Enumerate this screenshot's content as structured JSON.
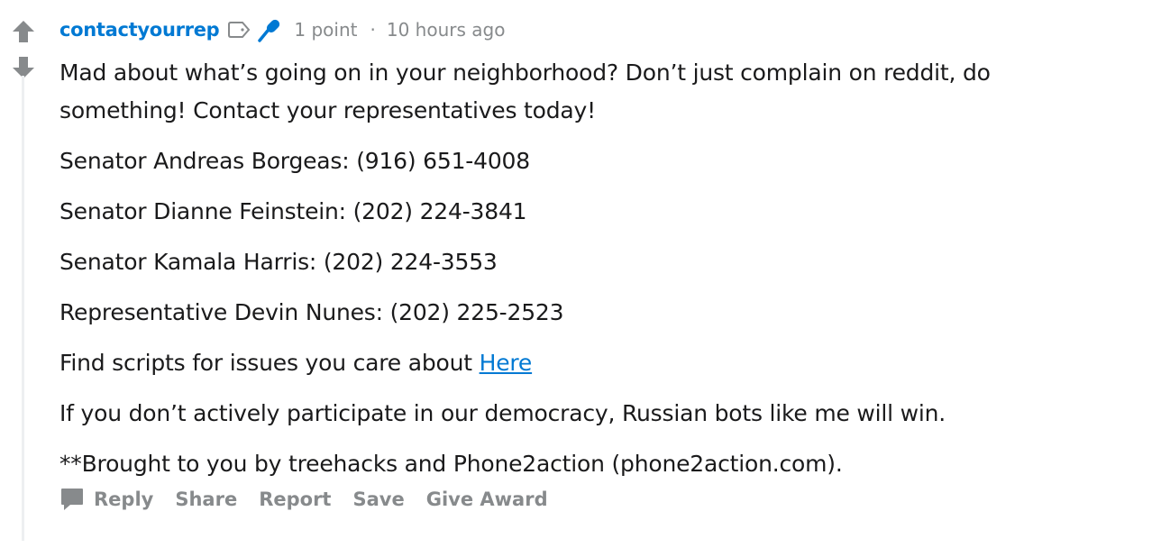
{
  "comment": {
    "author": "contactyourrep",
    "score": "1 point",
    "separator": "·",
    "time": "10 hours ago",
    "paragraphs": {
      "p1": "Mad about what’s going on in your neighborhood? Don’t just complain on reddit, do something! Contact your representatives today!",
      "p2": "Senator Andreas Borgeas: (916) 651-4008",
      "p3": "Senator Dianne Feinstein: (202) 224-3841",
      "p4": "Senator Kamala Harris: (202) 224-3553",
      "p5": "Representative Devin Nunes: (202) 225-2523",
      "p6_prefix": "Find scripts for issues you care about ",
      "p6_link": "Here",
      "p7": "If you don’t actively participate in our democracy, Russian bots like me will win.",
      "p8": "**Brought to you by treehacks and Phone2action (phone2action.com)."
    },
    "actions": {
      "reply": "Reply",
      "share": "Share",
      "report": "Report",
      "save": "Save",
      "give_award": "Give Award"
    },
    "icons": {
      "upvote": "upvote-arrow-icon",
      "downvote": "downvote-arrow-icon",
      "tag": "tag-icon",
      "microphone": "microphone-icon",
      "reply": "speech-bubble-icon"
    },
    "colors": {
      "author": "#0079d3",
      "meta": "#878a8c",
      "arrow": "#878a8c",
      "link": "#0079d3",
      "thread_line": "#edeff1"
    }
  }
}
